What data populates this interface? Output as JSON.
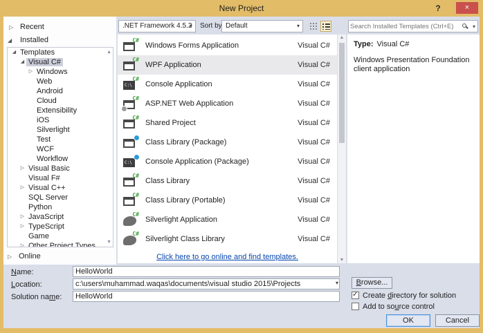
{
  "window": {
    "title": "New Project",
    "help_label": "?",
    "close_label": "×"
  },
  "toolbar": {
    "framework_value": ".NET Framework 4.5.2",
    "sort_by_label": "Sort by:",
    "sort_value": "Default"
  },
  "search": {
    "placeholder": "Search Installed Templates (Ctrl+E)"
  },
  "left_nav": {
    "recent": "Recent",
    "installed": "Installed",
    "online": "Online",
    "tree": [
      {
        "label": "Templates",
        "level": 0,
        "arrow": "expanded",
        "selected": false
      },
      {
        "label": "Visual C#",
        "level": 1,
        "arrow": "expanded",
        "selected": true
      },
      {
        "label": "Windows",
        "level": 2,
        "arrow": "collapsed",
        "selected": false
      },
      {
        "label": "Web",
        "level": 2,
        "arrow": "",
        "selected": false
      },
      {
        "label": "Android",
        "level": 2,
        "arrow": "",
        "selected": false
      },
      {
        "label": "Cloud",
        "level": 2,
        "arrow": "",
        "selected": false
      },
      {
        "label": "Extensibility",
        "level": 2,
        "arrow": "",
        "selected": false
      },
      {
        "label": "iOS",
        "level": 2,
        "arrow": "",
        "selected": false
      },
      {
        "label": "Silverlight",
        "level": 2,
        "arrow": "",
        "selected": false
      },
      {
        "label": "Test",
        "level": 2,
        "arrow": "",
        "selected": false
      },
      {
        "label": "WCF",
        "level": 2,
        "arrow": "",
        "selected": false
      },
      {
        "label": "Workflow",
        "level": 2,
        "arrow": "",
        "selected": false
      },
      {
        "label": "Visual Basic",
        "level": 1,
        "arrow": "collapsed",
        "selected": false
      },
      {
        "label": "Visual F#",
        "level": 1,
        "arrow": "",
        "selected": false
      },
      {
        "label": "Visual C++",
        "level": 1,
        "arrow": "collapsed",
        "selected": false
      },
      {
        "label": "SQL Server",
        "level": 1,
        "arrow": "",
        "selected": false
      },
      {
        "label": "Python",
        "level": 1,
        "arrow": "",
        "selected": false
      },
      {
        "label": "JavaScript",
        "level": 1,
        "arrow": "collapsed",
        "selected": false
      },
      {
        "label": "TypeScript",
        "level": 1,
        "arrow": "collapsed",
        "selected": false
      },
      {
        "label": "Game",
        "level": 1,
        "arrow": "",
        "selected": false
      },
      {
        "label": "Other Project Types",
        "level": 1,
        "arrow": "collapsed",
        "selected": false
      }
    ]
  },
  "templates": {
    "icon_badge": "C#",
    "items": [
      {
        "name": "Windows Forms Application",
        "lang": "Visual C#",
        "icon": "winforms-app-icon",
        "style": "win",
        "selected": false
      },
      {
        "name": "WPF Application",
        "lang": "Visual C#",
        "icon": "wpf-app-icon",
        "style": "win",
        "selected": true
      },
      {
        "name": "Console Application",
        "lang": "Visual C#",
        "icon": "console-app-icon",
        "style": "dark",
        "selected": false
      },
      {
        "name": "ASP.NET Web Application",
        "lang": "Visual C#",
        "icon": "aspnet-web-app-icon",
        "style": "web",
        "selected": false
      },
      {
        "name": "Shared Project",
        "lang": "Visual C#",
        "icon": "shared-project-icon",
        "style": "win",
        "selected": false
      },
      {
        "name": "Class Library (Package)",
        "lang": "Visual C#",
        "icon": "class-library-package-icon",
        "style": "pkg",
        "selected": false
      },
      {
        "name": "Console Application (Package)",
        "lang": "Visual C#",
        "icon": "console-app-package-icon",
        "style": "darkpkg",
        "selected": false
      },
      {
        "name": "Class Library",
        "lang": "Visual C#",
        "icon": "class-library-icon",
        "style": "win",
        "selected": false
      },
      {
        "name": "Class Library (Portable)",
        "lang": "Visual C#",
        "icon": "class-library-portable-icon",
        "style": "win",
        "selected": false
      },
      {
        "name": "Silverlight Application",
        "lang": "Visual C#",
        "icon": "silverlight-app-icon",
        "style": "sl",
        "selected": false
      },
      {
        "name": "Silverlight Class Library",
        "lang": "Visual C#",
        "icon": "silverlight-class-library-icon",
        "style": "sl",
        "selected": false
      }
    ],
    "online_link": "Click here to go online and find templates."
  },
  "details": {
    "type_label": "Type:",
    "type_value": "Visual C#",
    "description": "Windows Presentation Foundation client application"
  },
  "footer": {
    "name_label": {
      "pre": "",
      "key": "N",
      "post": "ame:"
    },
    "name_value": "HelloWorld",
    "location_label": {
      "pre": "",
      "key": "L",
      "post": "ocation:"
    },
    "location_value": "c:\\users\\muhammad.waqas\\documents\\visual studio 2015\\Projects",
    "solution_label": {
      "pre": "Solution na",
      "key": "m",
      "post": "e:"
    },
    "solution_value": "HelloWorld",
    "browse_label": {
      "pre": "",
      "key": "B",
      "post": "rowse..."
    },
    "checkbox_create": {
      "pre": "Create ",
      "key": "d",
      "post": "irectory for solution",
      "checked": true
    },
    "checkbox_source": {
      "pre": "Add to so",
      "key": "u",
      "post": "rce control",
      "checked": false
    },
    "ok_label": "OK",
    "cancel_label": "Cancel"
  },
  "colors": {
    "accent_gold": "#E3BC68",
    "close_red": "#C9504C",
    "dialog_bg": "#D9DEE9",
    "selection_gray": "#CCCEDB",
    "list_selection": "#E9E9EC",
    "link_blue": "#0645AD",
    "csharp_green": "#3F9E3F",
    "package_blue": "#2E9BD6"
  }
}
